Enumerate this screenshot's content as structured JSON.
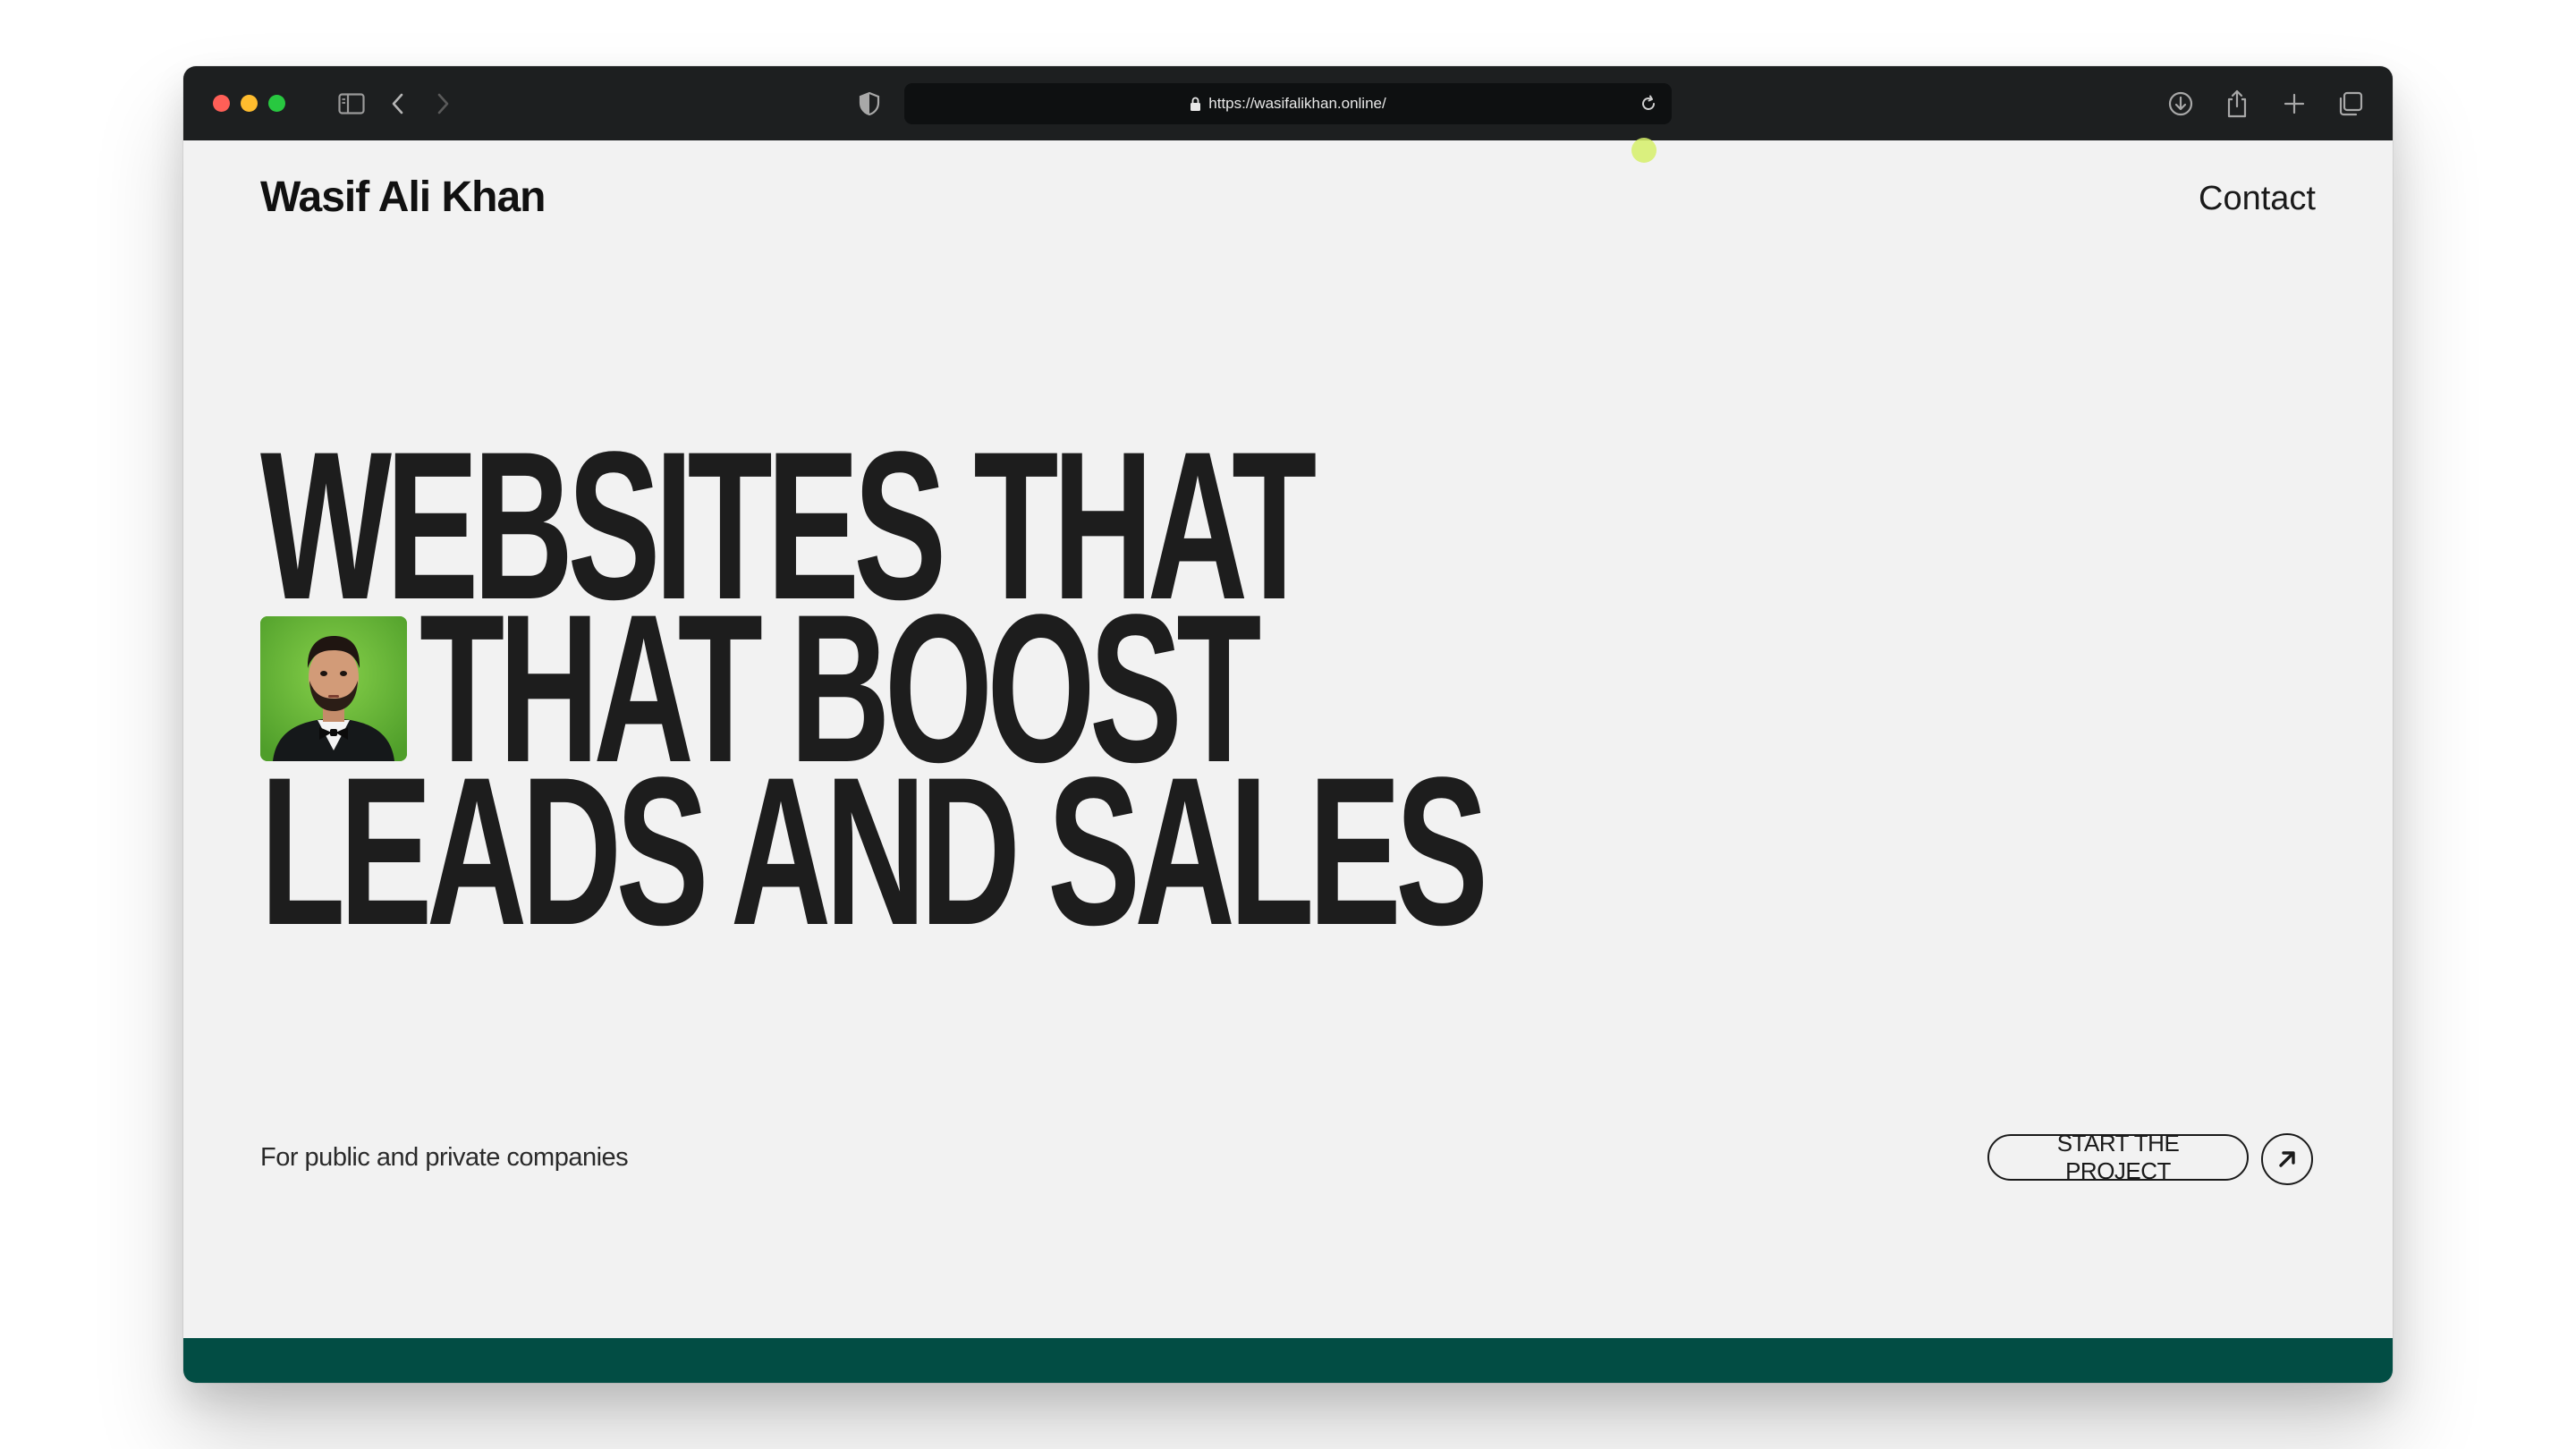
{
  "browser": {
    "url": "https://wasifalikhan.online/"
  },
  "header": {
    "brand": "Wasif Ali Khan",
    "nav_contact": "Contact"
  },
  "hero": {
    "line1": "WEBSITES THAT",
    "line2": "THAT BOOST",
    "line3": "LEADS AND SALES"
  },
  "subtitle": "For public and private companies",
  "cta": {
    "label": "START THE PROJECT"
  },
  "colors": {
    "accent_green": "#024d44",
    "avatar_bg": "#6fbf3a",
    "page_bg": "#f2f2f2",
    "chrome_bg": "#1d1f20"
  },
  "icons": {
    "sidebar": "sidebar-icon",
    "back": "chevron-left-icon",
    "forward": "chevron-right-icon",
    "shield": "shield-icon",
    "lock": "lock-icon",
    "reload": "reload-icon",
    "download": "download-icon",
    "share": "share-icon",
    "new_tab": "plus-icon",
    "tabs": "tabs-icon",
    "cta_arrow": "arrow-up-right-icon"
  }
}
